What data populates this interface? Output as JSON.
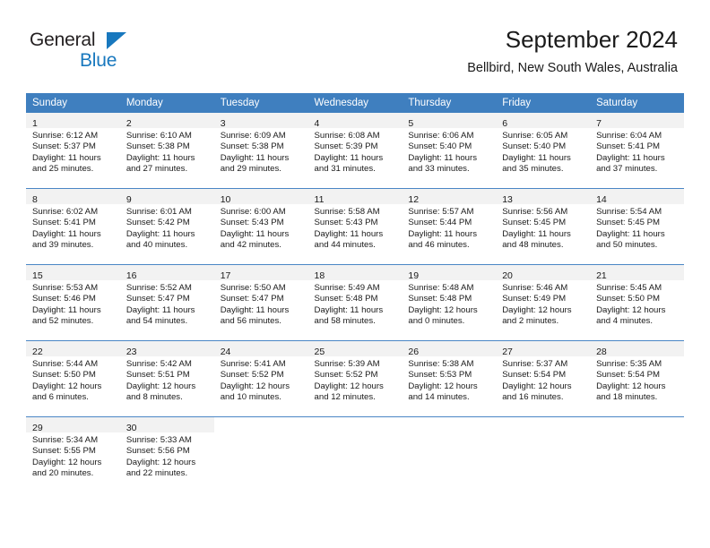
{
  "brand": {
    "name_part1": "General",
    "name_part2": "Blue",
    "accent_color": "#1878be"
  },
  "header": {
    "title": "September 2024",
    "location": "Bellbird, New South Wales, Australia"
  },
  "calendar": {
    "header_bg": "#3f7fbf",
    "daynum_bg": "#f2f2f2",
    "weekday_headers": [
      "Sunday",
      "Monday",
      "Tuesday",
      "Wednesday",
      "Thursday",
      "Friday",
      "Saturday"
    ],
    "weeks": [
      [
        {
          "day": "1",
          "sunrise": "Sunrise: 6:12 AM",
          "sunset": "Sunset: 5:37 PM",
          "daylight_1": "Daylight: 11 hours",
          "daylight_2": "and 25 minutes."
        },
        {
          "day": "2",
          "sunrise": "Sunrise: 6:10 AM",
          "sunset": "Sunset: 5:38 PM",
          "daylight_1": "Daylight: 11 hours",
          "daylight_2": "and 27 minutes."
        },
        {
          "day": "3",
          "sunrise": "Sunrise: 6:09 AM",
          "sunset": "Sunset: 5:38 PM",
          "daylight_1": "Daylight: 11 hours",
          "daylight_2": "and 29 minutes."
        },
        {
          "day": "4",
          "sunrise": "Sunrise: 6:08 AM",
          "sunset": "Sunset: 5:39 PM",
          "daylight_1": "Daylight: 11 hours",
          "daylight_2": "and 31 minutes."
        },
        {
          "day": "5",
          "sunrise": "Sunrise: 6:06 AM",
          "sunset": "Sunset: 5:40 PM",
          "daylight_1": "Daylight: 11 hours",
          "daylight_2": "and 33 minutes."
        },
        {
          "day": "6",
          "sunrise": "Sunrise: 6:05 AM",
          "sunset": "Sunset: 5:40 PM",
          "daylight_1": "Daylight: 11 hours",
          "daylight_2": "and 35 minutes."
        },
        {
          "day": "7",
          "sunrise": "Sunrise: 6:04 AM",
          "sunset": "Sunset: 5:41 PM",
          "daylight_1": "Daylight: 11 hours",
          "daylight_2": "and 37 minutes."
        }
      ],
      [
        {
          "day": "8",
          "sunrise": "Sunrise: 6:02 AM",
          "sunset": "Sunset: 5:41 PM",
          "daylight_1": "Daylight: 11 hours",
          "daylight_2": "and 39 minutes."
        },
        {
          "day": "9",
          "sunrise": "Sunrise: 6:01 AM",
          "sunset": "Sunset: 5:42 PM",
          "daylight_1": "Daylight: 11 hours",
          "daylight_2": "and 40 minutes."
        },
        {
          "day": "10",
          "sunrise": "Sunrise: 6:00 AM",
          "sunset": "Sunset: 5:43 PM",
          "daylight_1": "Daylight: 11 hours",
          "daylight_2": "and 42 minutes."
        },
        {
          "day": "11",
          "sunrise": "Sunrise: 5:58 AM",
          "sunset": "Sunset: 5:43 PM",
          "daylight_1": "Daylight: 11 hours",
          "daylight_2": "and 44 minutes."
        },
        {
          "day": "12",
          "sunrise": "Sunrise: 5:57 AM",
          "sunset": "Sunset: 5:44 PM",
          "daylight_1": "Daylight: 11 hours",
          "daylight_2": "and 46 minutes."
        },
        {
          "day": "13",
          "sunrise": "Sunrise: 5:56 AM",
          "sunset": "Sunset: 5:45 PM",
          "daylight_1": "Daylight: 11 hours",
          "daylight_2": "and 48 minutes."
        },
        {
          "day": "14",
          "sunrise": "Sunrise: 5:54 AM",
          "sunset": "Sunset: 5:45 PM",
          "daylight_1": "Daylight: 11 hours",
          "daylight_2": "and 50 minutes."
        }
      ],
      [
        {
          "day": "15",
          "sunrise": "Sunrise: 5:53 AM",
          "sunset": "Sunset: 5:46 PM",
          "daylight_1": "Daylight: 11 hours",
          "daylight_2": "and 52 minutes."
        },
        {
          "day": "16",
          "sunrise": "Sunrise: 5:52 AM",
          "sunset": "Sunset: 5:47 PM",
          "daylight_1": "Daylight: 11 hours",
          "daylight_2": "and 54 minutes."
        },
        {
          "day": "17",
          "sunrise": "Sunrise: 5:50 AM",
          "sunset": "Sunset: 5:47 PM",
          "daylight_1": "Daylight: 11 hours",
          "daylight_2": "and 56 minutes."
        },
        {
          "day": "18",
          "sunrise": "Sunrise: 5:49 AM",
          "sunset": "Sunset: 5:48 PM",
          "daylight_1": "Daylight: 11 hours",
          "daylight_2": "and 58 minutes."
        },
        {
          "day": "19",
          "sunrise": "Sunrise: 5:48 AM",
          "sunset": "Sunset: 5:48 PM",
          "daylight_1": "Daylight: 12 hours",
          "daylight_2": "and 0 minutes."
        },
        {
          "day": "20",
          "sunrise": "Sunrise: 5:46 AM",
          "sunset": "Sunset: 5:49 PM",
          "daylight_1": "Daylight: 12 hours",
          "daylight_2": "and 2 minutes."
        },
        {
          "day": "21",
          "sunrise": "Sunrise: 5:45 AM",
          "sunset": "Sunset: 5:50 PM",
          "daylight_1": "Daylight: 12 hours",
          "daylight_2": "and 4 minutes."
        }
      ],
      [
        {
          "day": "22",
          "sunrise": "Sunrise: 5:44 AM",
          "sunset": "Sunset: 5:50 PM",
          "daylight_1": "Daylight: 12 hours",
          "daylight_2": "and 6 minutes."
        },
        {
          "day": "23",
          "sunrise": "Sunrise: 5:42 AM",
          "sunset": "Sunset: 5:51 PM",
          "daylight_1": "Daylight: 12 hours",
          "daylight_2": "and 8 minutes."
        },
        {
          "day": "24",
          "sunrise": "Sunrise: 5:41 AM",
          "sunset": "Sunset: 5:52 PM",
          "daylight_1": "Daylight: 12 hours",
          "daylight_2": "and 10 minutes."
        },
        {
          "day": "25",
          "sunrise": "Sunrise: 5:39 AM",
          "sunset": "Sunset: 5:52 PM",
          "daylight_1": "Daylight: 12 hours",
          "daylight_2": "and 12 minutes."
        },
        {
          "day": "26",
          "sunrise": "Sunrise: 5:38 AM",
          "sunset": "Sunset: 5:53 PM",
          "daylight_1": "Daylight: 12 hours",
          "daylight_2": "and 14 minutes."
        },
        {
          "day": "27",
          "sunrise": "Sunrise: 5:37 AM",
          "sunset": "Sunset: 5:54 PM",
          "daylight_1": "Daylight: 12 hours",
          "daylight_2": "and 16 minutes."
        },
        {
          "day": "28",
          "sunrise": "Sunrise: 5:35 AM",
          "sunset": "Sunset: 5:54 PM",
          "daylight_1": "Daylight: 12 hours",
          "daylight_2": "and 18 minutes."
        }
      ],
      [
        {
          "day": "29",
          "sunrise": "Sunrise: 5:34 AM",
          "sunset": "Sunset: 5:55 PM",
          "daylight_1": "Daylight: 12 hours",
          "daylight_2": "and 20 minutes."
        },
        {
          "day": "30",
          "sunrise": "Sunrise: 5:33 AM",
          "sunset": "Sunset: 5:56 PM",
          "daylight_1": "Daylight: 12 hours",
          "daylight_2": "and 22 minutes."
        },
        {
          "day": "",
          "sunrise": "",
          "sunset": "",
          "daylight_1": "",
          "daylight_2": ""
        },
        {
          "day": "",
          "sunrise": "",
          "sunset": "",
          "daylight_1": "",
          "daylight_2": ""
        },
        {
          "day": "",
          "sunrise": "",
          "sunset": "",
          "daylight_1": "",
          "daylight_2": ""
        },
        {
          "day": "",
          "sunrise": "",
          "sunset": "",
          "daylight_1": "",
          "daylight_2": ""
        },
        {
          "day": "",
          "sunrise": "",
          "sunset": "",
          "daylight_1": "",
          "daylight_2": ""
        }
      ]
    ]
  }
}
